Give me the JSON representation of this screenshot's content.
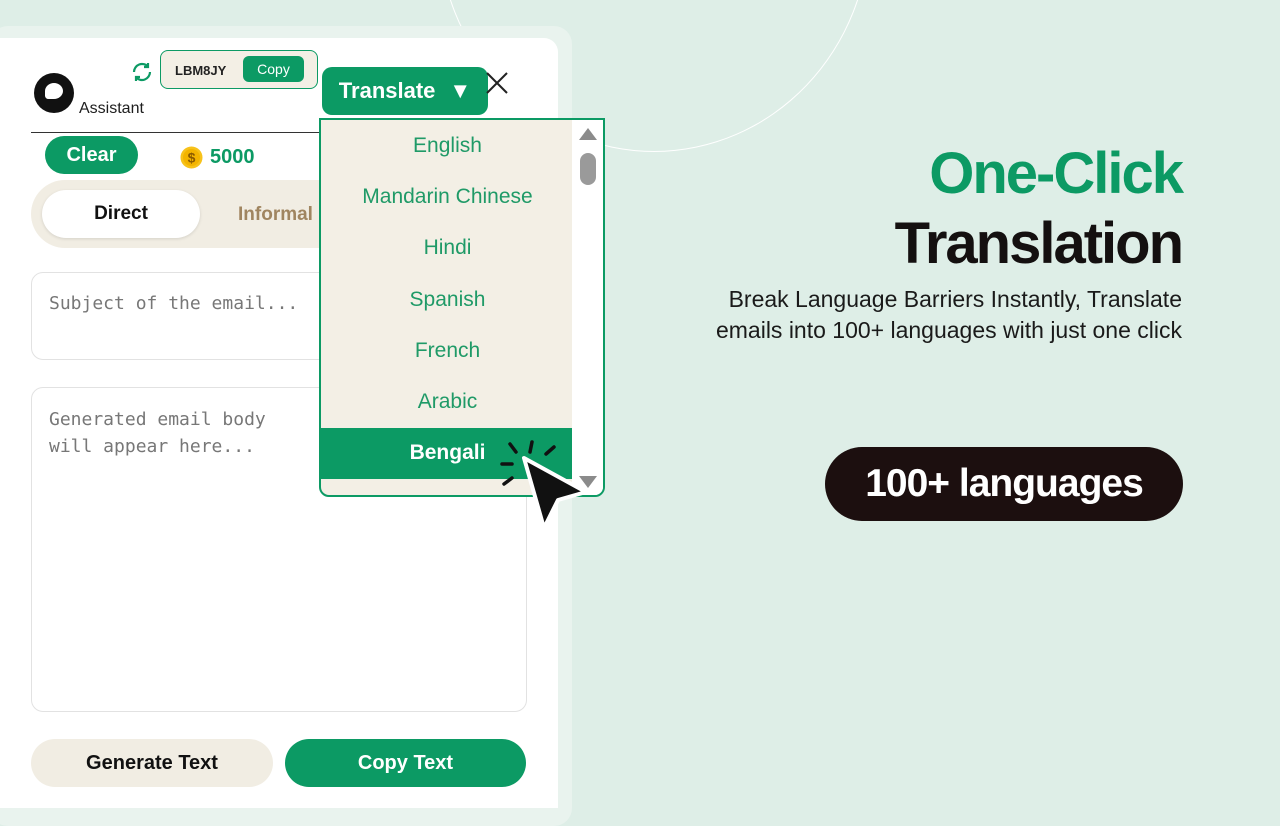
{
  "extension": {
    "app_label": "Assistant",
    "code": {
      "value": "LBM8JY",
      "copy_label": "Copy"
    },
    "translate_label": "Translate",
    "translate_caret": "▼",
    "clear_label": "Clear",
    "credits": "5000",
    "tones": {
      "active": "Direct",
      "next": "Informal"
    },
    "subject_placeholder": "Subject of the email...",
    "body_placeholder": "Generated email body will appear here...",
    "generate_label": "Generate Text",
    "copy_text_label": "Copy Text",
    "languages": {
      "items": [
        "English",
        "Mandarin Chinese",
        "Hindi",
        "Spanish",
        "French",
        "Arabic",
        "Bengali"
      ],
      "selected": "Bengali"
    }
  },
  "promo": {
    "headline_part1": "One-Click",
    "headline_part2": "Translation",
    "subtext": "Break Language Barriers Instantly, Translate emails into 100+ languages with just one click",
    "badge": "100+ languages"
  },
  "colors": {
    "accent": "#0c9a64",
    "background": "#deeee7",
    "cream": "#f3efe5",
    "dark": "#1c0f0f"
  },
  "icons": [
    "refresh-icon",
    "close-icon",
    "coin-icon",
    "logo-icon",
    "cursor-icon",
    "chevron-down-icon"
  ]
}
